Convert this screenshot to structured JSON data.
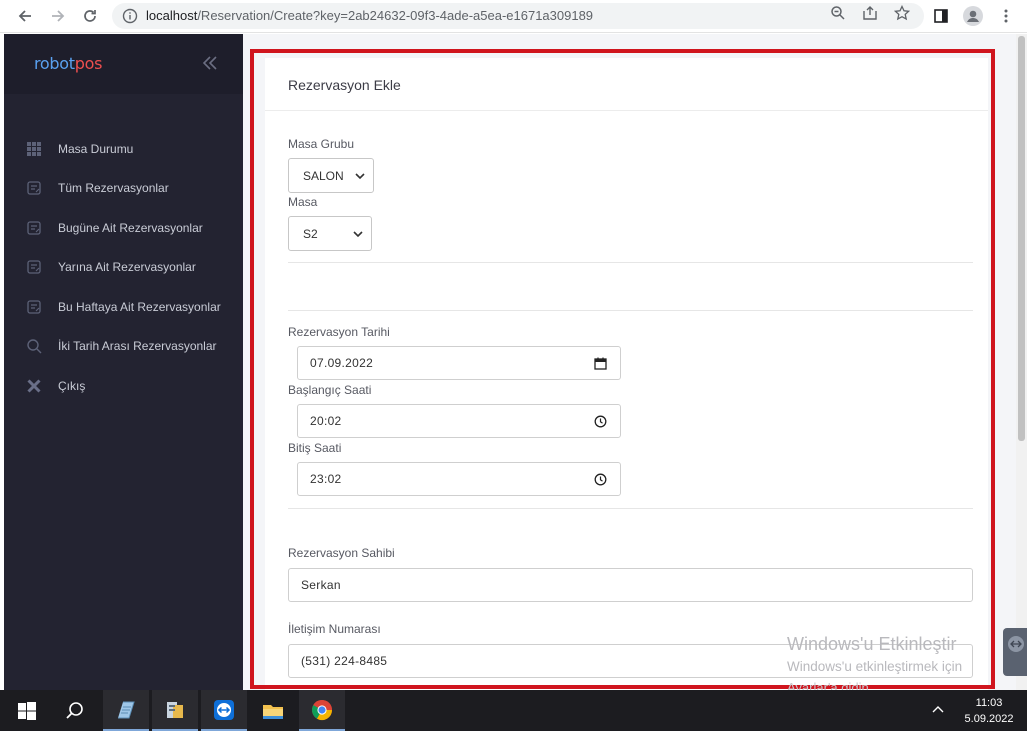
{
  "browser": {
    "url_host": "localhost",
    "url_path": "/Reservation/Create?key=2ab24632-09f3-4ade-a5ea-e1671a309189"
  },
  "sidebar": {
    "logo_part1": "robot",
    "logo_part2": "pos",
    "items": [
      {
        "label": "Masa Durumu",
        "icon": "grid-icon"
      },
      {
        "label": "Tüm Rezervasyonlar",
        "icon": "reservation-list-icon"
      },
      {
        "label": "Bugüne Ait Rezervasyonlar",
        "icon": "reservation-list-icon"
      },
      {
        "label": "Yarına Ait Rezervasyonlar",
        "icon": "reservation-list-icon"
      },
      {
        "label": "Bu Haftaya Ait Rezervasyonlar",
        "icon": "reservation-list-icon"
      },
      {
        "label": "İki Tarih Arası Rezervasyonlar",
        "icon": "search-icon"
      },
      {
        "label": "Çıkış",
        "icon": "close-icon"
      }
    ]
  },
  "form": {
    "title": "Rezervasyon Ekle",
    "masa_grubu_label": "Masa Grubu",
    "masa_grubu_value": "SALON",
    "masa_label": "Masa",
    "masa_value": "S2",
    "tarih_label": "Rezervasyon Tarihi",
    "tarih_value": "07.09.2022",
    "baslangic_label": "Başlangıç Saati",
    "baslangic_value": "20:02",
    "bitis_label": "Bitiş Saati",
    "bitis_value": "23:02",
    "sahip_label": "Rezervasyon Sahibi",
    "sahip_value": "Serkan",
    "telefon_label": "İletişim Numarası",
    "telefon_value": "(531) 224-8485"
  },
  "watermark": {
    "line1": "Windows'u Etkinleştir",
    "line2": "Windows'u etkinleştirmek için",
    "line3": "Ayarlar'a gidin."
  },
  "taskbar": {
    "time": "11:03",
    "date": "5.09.2022"
  },
  "colors": {
    "sidebar_bg": "#232331",
    "highlight": "#d0151e",
    "logo_blue": "#5aa1f0",
    "logo_red": "#ef4f4f"
  }
}
